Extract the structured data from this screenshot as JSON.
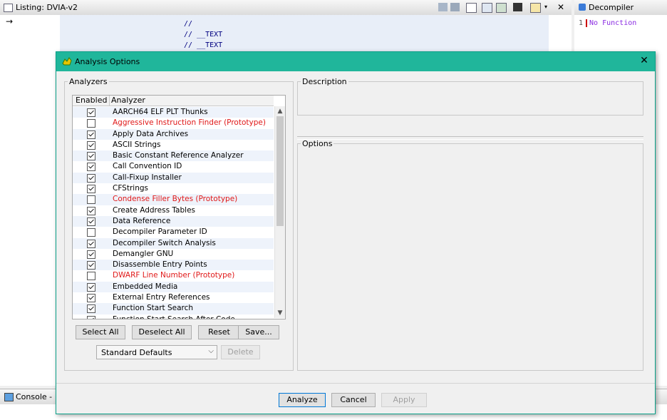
{
  "background": {
    "listing_title": "Listing:  DVIA-v2",
    "code_lines": [
      "//",
      "// __TEXT",
      "// __TEXT"
    ],
    "decompiler_title": "Decompiler",
    "decompiler_line_num": "1",
    "decompiler_text": "No Function",
    "console_title": "Console -"
  },
  "dialog": {
    "title": "Analysis Options",
    "analyzers_legend": "Analyzers",
    "description_legend": "Description",
    "options_legend": "Options",
    "col_enabled": "Enabled",
    "col_analyzer": "Analyzer",
    "analyzers": [
      {
        "name": "AARCH64 ELF PLT Thunks",
        "enabled": true,
        "prototype": false
      },
      {
        "name": "Aggressive Instruction Finder (Prototype)",
        "enabled": false,
        "prototype": true
      },
      {
        "name": "Apply Data Archives",
        "enabled": true,
        "prototype": false
      },
      {
        "name": "ASCII Strings",
        "enabled": true,
        "prototype": false
      },
      {
        "name": "Basic Constant Reference Analyzer",
        "enabled": true,
        "prototype": false
      },
      {
        "name": "Call Convention ID",
        "enabled": true,
        "prototype": false
      },
      {
        "name": "Call-Fixup Installer",
        "enabled": true,
        "prototype": false
      },
      {
        "name": "CFStrings",
        "enabled": true,
        "prototype": false
      },
      {
        "name": "Condense Filler Bytes (Prototype)",
        "enabled": false,
        "prototype": true
      },
      {
        "name": "Create Address Tables",
        "enabled": true,
        "prototype": false
      },
      {
        "name": "Data Reference",
        "enabled": true,
        "prototype": false
      },
      {
        "name": "Decompiler Parameter ID",
        "enabled": false,
        "prototype": false
      },
      {
        "name": "Decompiler Switch Analysis",
        "enabled": true,
        "prototype": false
      },
      {
        "name": "Demangler GNU",
        "enabled": true,
        "prototype": false
      },
      {
        "name": "Disassemble Entry Points",
        "enabled": true,
        "prototype": false
      },
      {
        "name": "DWARF Line Number (Prototype)",
        "enabled": false,
        "prototype": true
      },
      {
        "name": "Embedded Media",
        "enabled": true,
        "prototype": false
      },
      {
        "name": "External Entry References",
        "enabled": true,
        "prototype": false
      },
      {
        "name": "Function Start Search",
        "enabled": true,
        "prototype": false
      },
      {
        "name": "Function Start Search After Code",
        "enabled": true,
        "prototype": false
      }
    ],
    "buttons": {
      "select_all": "Select All",
      "deselect_all": "Deselect All",
      "reset": "Reset",
      "save": "Save...",
      "delete": "Delete",
      "analyze": "Analyze",
      "cancel": "Cancel",
      "apply": "Apply"
    },
    "defaults_combo_value": "Standard Defaults"
  },
  "colors": {
    "titlebar": "#20b69b",
    "prototype_text": "#e01818",
    "decompiler_text": "#8a2be2"
  }
}
